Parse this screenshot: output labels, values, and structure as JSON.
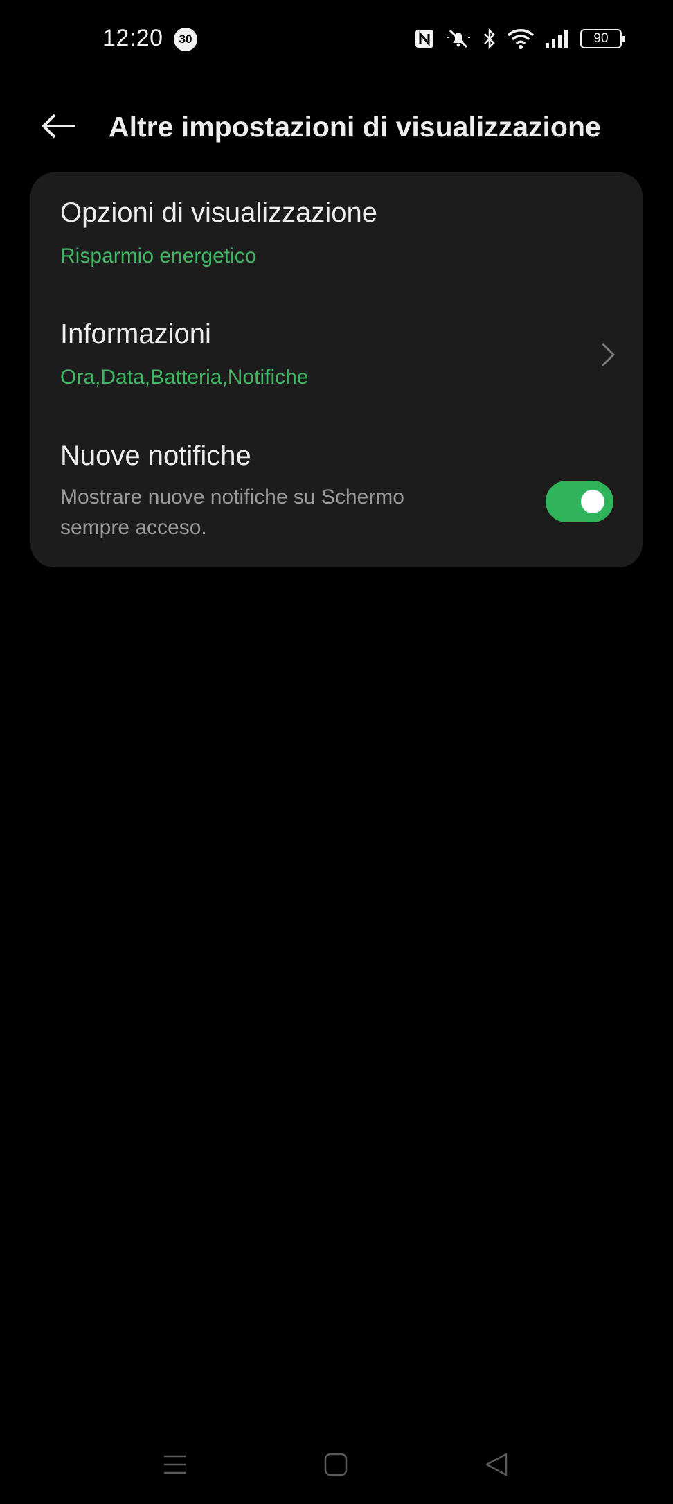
{
  "status_bar": {
    "time": "12:20",
    "notification_count": "30",
    "battery_level": "90",
    "icons": [
      "nfc-icon",
      "silent-icon",
      "bluetooth-icon",
      "wifi-icon",
      "signal-icon",
      "battery-icon"
    ]
  },
  "header": {
    "title": "Altre impostazioni di visualizzazione",
    "back_icon": "arrow-left-icon"
  },
  "settings": {
    "display_options": {
      "title": "Opzioni di visualizzazione",
      "value": "Risparmio energetico"
    },
    "information": {
      "title": "Informazioni",
      "value": "Ora,Data,Batteria,Notifiche",
      "chevron_icon": "chevron-right-icon"
    },
    "new_notifications": {
      "title": "Nuove notifiche",
      "description": "Mostrare nuove notifiche su Schermo sempre acceso.",
      "toggle_on": true
    }
  },
  "nav_bar": {
    "icons": [
      "menu-icon",
      "home-icon",
      "back-triangle-icon"
    ]
  },
  "colors": {
    "accent": "#3fb763",
    "toggle_track": "#2fb35b",
    "card_background": "#1c1c1c",
    "background": "#000000"
  }
}
